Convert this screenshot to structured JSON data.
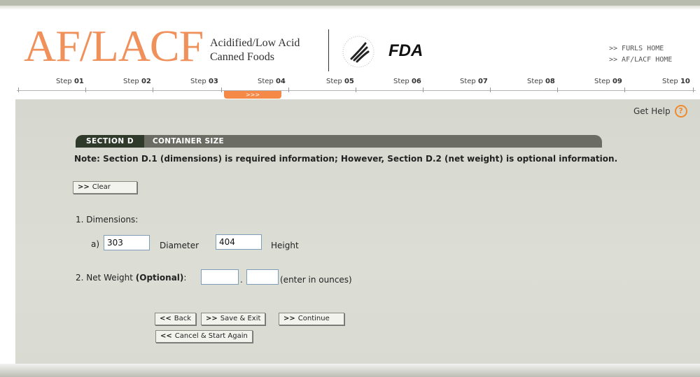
{
  "header": {
    "logo_text": "AF/LACF",
    "subtitle_line1": "Acidified/Low Acid",
    "subtitle_line2": "Canned Foods",
    "fda_text": "FDA",
    "links": [
      ">> FURLS HOME",
      ">> AF/LACF HOME"
    ]
  },
  "steps": [
    {
      "prefix": "Step",
      "num": "01"
    },
    {
      "prefix": "Step",
      "num": "02"
    },
    {
      "prefix": "Step",
      "num": "03"
    },
    {
      "prefix": "Step",
      "num": "04"
    },
    {
      "prefix": "Step",
      "num": "05"
    },
    {
      "prefix": "Step",
      "num": "06"
    },
    {
      "prefix": "Step",
      "num": "07"
    },
    {
      "prefix": "Step",
      "num": "08"
    },
    {
      "prefix": "Step",
      "num": "09"
    },
    {
      "prefix": "Step",
      "num": "10"
    }
  ],
  "current_step_marker": ">>>",
  "help": {
    "label": "Get Help",
    "icon": "?"
  },
  "section": {
    "tab": "SECTION D",
    "title": "CONTAINER SIZE"
  },
  "note": "Note: Section D.1 (dimensions) is required information; However, Section D.2 (net weight) is optional information.",
  "form": {
    "clear_label": "Clear",
    "dimensions_label": "1. Dimensions:",
    "a_label": "a)",
    "diameter_value": "303",
    "diameter_label": "Diameter",
    "height_value": "404",
    "height_label": "Height",
    "net_weight_label": "2. Net Weight",
    "optional_label": "(Optional)",
    "colon": ":",
    "net_weight_whole": "",
    "dot": ".",
    "net_weight_fraction": "",
    "ounces_label": "(enter in ounces)"
  },
  "buttons": {
    "back": "Back",
    "save_exit": "Save & Exit",
    "continue": "Continue",
    "cancel": "Cancel & Start Again"
  },
  "colors": {
    "accent": "#f58a48",
    "section_bar": "#6b6d64",
    "panel": "#d8dad1"
  }
}
